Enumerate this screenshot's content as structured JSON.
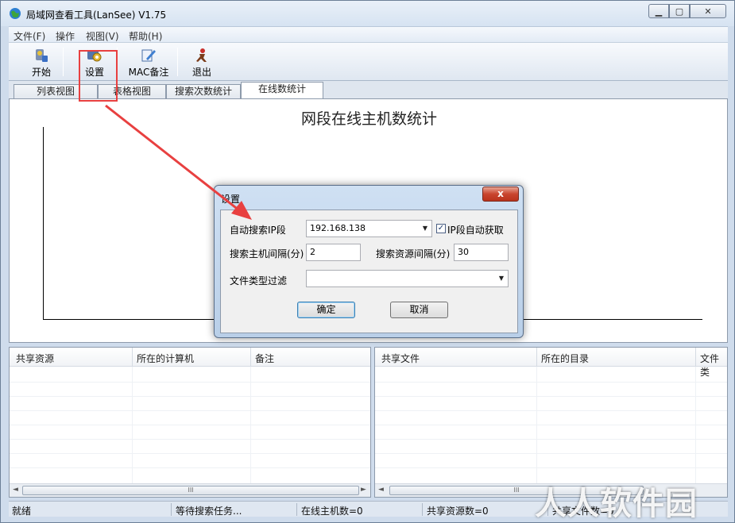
{
  "window": {
    "title": "局域网查看工具(LanSee) V1.75"
  },
  "menu": [
    "文件(F)",
    "操作",
    "视图(V)",
    "帮助(H)"
  ],
  "toolbar": {
    "start": "开始",
    "settings": "设置",
    "mac_note": "MAC备注",
    "exit": "退出"
  },
  "tabs": [
    "列表视图",
    "表格视图",
    "搜索次数统计",
    "在线数统计"
  ],
  "active_tab": 3,
  "chart": {
    "title": "网段在线主机数统计"
  },
  "left_list": {
    "columns": [
      "共享资源",
      "所在的计算机",
      "备注"
    ]
  },
  "right_list": {
    "columns": [
      "共享文件",
      "所在的目录",
      "文件类"
    ]
  },
  "scroll_thumb_glyph": "III",
  "status": {
    "ready": "就绪",
    "waiting": "等待搜索任务...",
    "online": "在线主机数=0",
    "shared": "共享资源数=0",
    "files": "共享文件数=0"
  },
  "dialog": {
    "title": "设置",
    "close_glyph": "x",
    "auto_ip_label": "自动搜索IP段",
    "ip_value": "192.168.138",
    "auto_ip_checkbox_label": "IP段自动获取",
    "auto_ip_checked": true,
    "host_interval_label": "搜索主机间隔(分)",
    "host_interval_value": "2",
    "res_interval_label": "搜索资源间隔(分)",
    "res_interval_value": "30",
    "filter_label": "文件类型过滤",
    "filter_value": "",
    "ok": "确定",
    "cancel": "取消"
  },
  "watermark": "人人软件园",
  "colors": {
    "annotation": "#e84040",
    "close_button": "#c9452e"
  }
}
